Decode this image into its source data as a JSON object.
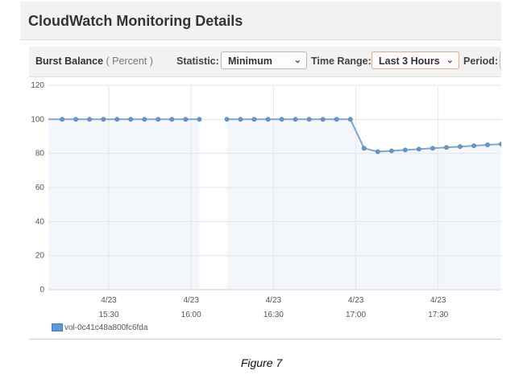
{
  "header": {
    "title": "CloudWatch Monitoring Details"
  },
  "toolbar": {
    "metric_name": "Burst Balance",
    "metric_unit": "( Percent )",
    "statistic_label": "Statistic:",
    "statistic_value": "Minimum",
    "time_range_label": "Time Range:",
    "time_range_value": "Last 3 Hours",
    "period_label": "Period:"
  },
  "caption": "Figure 7",
  "chart_data": {
    "type": "line",
    "ylim": [
      0,
      120
    ],
    "yticks": [
      0,
      20,
      40,
      60,
      80,
      100,
      120
    ],
    "xlim": [
      15.133,
      17.883
    ],
    "xticks": [
      {
        "value": 15.5,
        "date": "4/23",
        "time": "15:30"
      },
      {
        "value": 16.0,
        "date": "4/23",
        "time": "16:00"
      },
      {
        "value": 16.5,
        "date": "4/23",
        "time": "16:30"
      },
      {
        "value": 17.0,
        "date": "4/23",
        "time": "17:00"
      },
      {
        "value": 17.5,
        "date": "4/23",
        "time": "17:30"
      }
    ],
    "grid": true,
    "legend_position": "bottom-left",
    "colors": {
      "line": "#7ea6d1",
      "marker": "#6a97c8",
      "area": "#dce8f4",
      "grid": "#e6e6e6"
    },
    "series": [
      {
        "name": "vol-0c41c48a800fc6fda",
        "segments": [
          [
            [
              15.133,
              100
            ],
            [
              15.217,
              100
            ],
            [
              15.3,
              100
            ],
            [
              15.383,
              100
            ],
            [
              15.467,
              100
            ],
            [
              15.55,
              100
            ],
            [
              15.633,
              100
            ],
            [
              15.717,
              100
            ],
            [
              15.8,
              100
            ],
            [
              15.883,
              100
            ],
            [
              15.967,
              100
            ],
            [
              16.05,
              100
            ]
          ],
          [
            [
              16.217,
              100
            ],
            [
              16.3,
              100
            ],
            [
              16.383,
              100
            ],
            [
              16.467,
              100
            ],
            [
              16.55,
              100
            ],
            [
              16.633,
              100
            ],
            [
              16.717,
              100
            ],
            [
              16.8,
              100
            ],
            [
              16.883,
              100
            ],
            [
              16.967,
              100
            ],
            [
              17.05,
              83
            ],
            [
              17.133,
              81
            ],
            [
              17.217,
              81.5
            ],
            [
              17.3,
              82
            ],
            [
              17.383,
              82.5
            ],
            [
              17.467,
              83
            ],
            [
              17.55,
              83.5
            ],
            [
              17.633,
              84
            ],
            [
              17.717,
              84.5
            ],
            [
              17.8,
              85
            ],
            [
              17.883,
              85.5
            ]
          ]
        ]
      }
    ]
  }
}
